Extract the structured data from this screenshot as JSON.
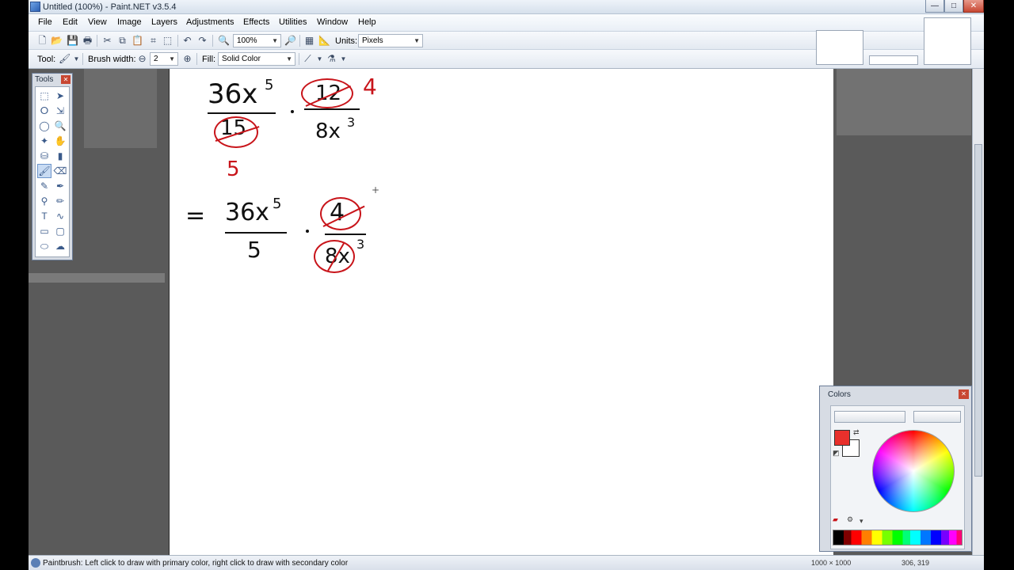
{
  "window": {
    "title": "Untitled (100%) - Paint.NET v3.5.4",
    "controls": {
      "minimize": "—",
      "maximize": "□",
      "close": "✕"
    }
  },
  "menu": [
    "File",
    "Edit",
    "View",
    "Image",
    "Layers",
    "Adjustments",
    "Effects",
    "Utilities",
    "Window",
    "Help"
  ],
  "toolbar": {
    "zoom_value": "100%",
    "units_label": "Units:",
    "units_value": "Pixels",
    "tool_label": "Tool:",
    "brush_width_label": "Brush width:",
    "brush_width_value": "2",
    "fill_label": "Fill:",
    "fill_value": "Solid Color"
  },
  "tools_window": {
    "title": "Tools",
    "close": "✕"
  },
  "colors_window": {
    "title": "Colors",
    "primary_color": "#e8302c",
    "secondary_color": "#ffffff",
    "button_less": "",
    "button_more": ""
  },
  "canvas_math": {
    "line1": {
      "num1": "36x",
      "exp1": "5",
      "den1": "15",
      "num2": "12",
      "den2": "8x",
      "exp2": "3",
      "red_top": "4",
      "red_bottom": "5"
    },
    "line2": {
      "equals": "=",
      "num1": "36x",
      "exp1": "5",
      "den1": "5",
      "num2": "4",
      "den2": "8x",
      "exp2": "3"
    }
  },
  "statusbar": {
    "message": "Paintbrush: Left click to draw with primary color, right click to draw with secondary color",
    "image_size": "1000 × 1000",
    "cursor_position": "306, 319"
  }
}
